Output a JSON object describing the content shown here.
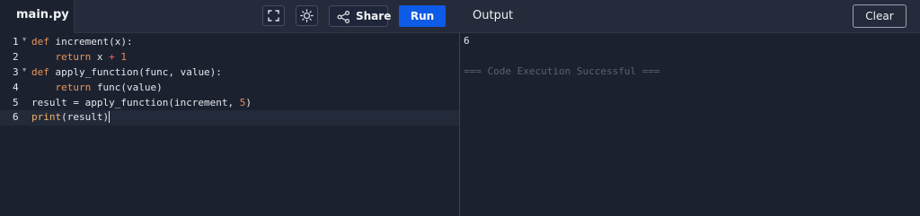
{
  "header": {
    "file_tab": "main.py",
    "share_label": "Share",
    "run_label": "Run",
    "output_title": "Output",
    "clear_label": "Clear"
  },
  "icons": {
    "fullscreen": "fullscreen-icon",
    "theme": "sun-icon",
    "share": "share-icon"
  },
  "colors": {
    "run_button": "#0e5be8",
    "background": "#1c2130",
    "header": "#252b3a",
    "keyword": "#e8965a",
    "number": "#f08a5a"
  },
  "editor": {
    "lines": [
      {
        "number": "1",
        "text": "def increment(x):"
      },
      {
        "number": "2",
        "text": "    return x + 1"
      },
      {
        "number": "3",
        "text": "def apply_function(func, value):"
      },
      {
        "number": "4",
        "text": "    return func(value)"
      },
      {
        "number": "5",
        "text": "result = apply_function(increment, 5)"
      },
      {
        "number": "6",
        "text": "print(result)"
      }
    ]
  },
  "output": {
    "result": "6",
    "status": "=== Code Execution Successful ==="
  }
}
